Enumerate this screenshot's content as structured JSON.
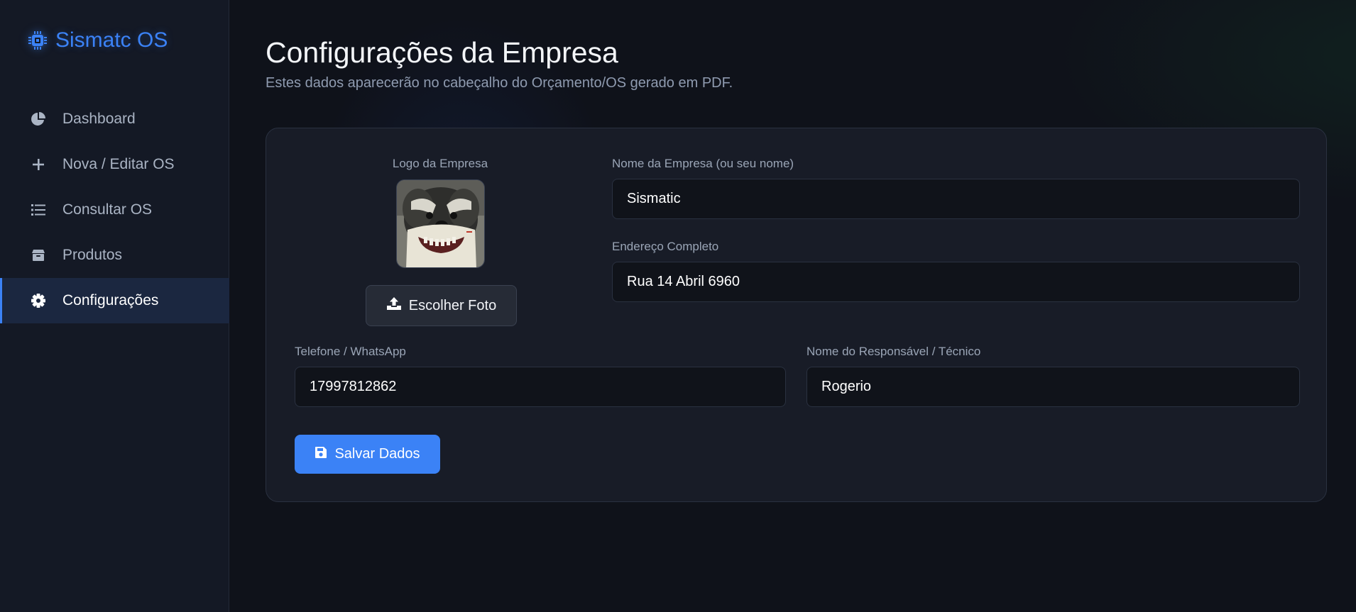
{
  "brand": {
    "name": "Sismatc OS",
    "icon": "cpu-icon",
    "color": "#3b82f6"
  },
  "sidebar": {
    "items": [
      {
        "label": "Dashboard",
        "icon": "pie-chart-icon",
        "active": false
      },
      {
        "label": "Nova / Editar OS",
        "icon": "plus-icon",
        "active": false
      },
      {
        "label": "Consultar OS",
        "icon": "list-icon",
        "active": false
      },
      {
        "label": "Produtos",
        "icon": "box-icon",
        "active": false
      },
      {
        "label": "Configurações",
        "icon": "gear-icon",
        "active": true
      }
    ]
  },
  "page": {
    "title": "Configurações da Empresa",
    "subtitle": "Estes dados aparecerão no cabeçalho do Orçamento/OS gerado em PDF."
  },
  "form": {
    "logo": {
      "label": "Logo da Empresa",
      "button_label": "Escolher Foto",
      "button_icon": "upload-icon"
    },
    "company_name": {
      "label": "Nome da Empresa (ou seu nome)",
      "value": "Sismatic"
    },
    "address": {
      "label": "Endereço Completo",
      "value": "Rua 14 Abril 6960"
    },
    "phone": {
      "label": "Telefone / WhatsApp",
      "value": "17997812862"
    },
    "responsible": {
      "label": "Nome do Responsável / Técnico",
      "value": "Rogerio"
    },
    "save_label": "Salvar Dados",
    "save_icon": "save-icon"
  }
}
